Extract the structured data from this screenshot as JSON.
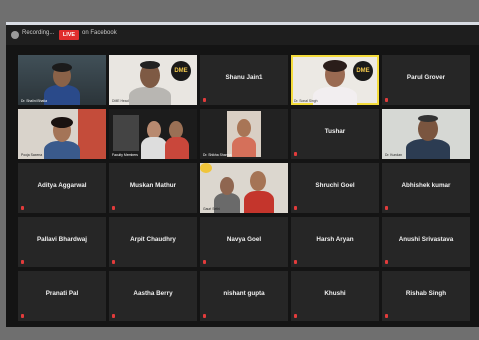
{
  "toolbar": {
    "recording": "Recording...",
    "live": "LIVE",
    "stream": "on Facebook"
  },
  "participants": [
    {
      "name": "Dr. Shalini Bhatia",
      "caption": "Dr. Shalini Bhatia"
    },
    {
      "name": "DME Head",
      "caption": "DME Head"
    },
    {
      "name": "Shanu Jain1"
    },
    {
      "name": "DME Host",
      "caption": "Dr. Sonal Singh"
    },
    {
      "name": "Parul Grover"
    },
    {
      "name": "Pooja Saxena",
      "caption": "Pooja Saxena"
    },
    {
      "name": "Faculty Members",
      "caption": "Faculty Members"
    },
    {
      "name": "Dr. Shikha Sharma",
      "caption": "Dr. Shikha Sharma"
    },
    {
      "name": "Tushar"
    },
    {
      "name": "Dr. Kundan",
      "caption": "Dr. Kundan"
    },
    {
      "name": "Aditya Aggarwal"
    },
    {
      "name": "Muskan Mathur"
    },
    {
      "name": "Gauri Sethi",
      "caption": "Gauri Sethi"
    },
    {
      "name": "Shruchi Goel"
    },
    {
      "name": "Abhishek kumar"
    },
    {
      "name": "Pallavi Bhardwaj"
    },
    {
      "name": "Arpit Chaudhry"
    },
    {
      "name": "Navya Goel"
    },
    {
      "name": "Harsh Aryan"
    },
    {
      "name": "Anushi Srivastava"
    },
    {
      "name": "Pranati Pal"
    },
    {
      "name": "Aastha Berry"
    },
    {
      "name": "nishant gupta"
    },
    {
      "name": "Khushi"
    },
    {
      "name": "Rishab Singh"
    }
  ],
  "logo_text": "DME",
  "colors": {
    "accent": "#f4dc3c",
    "live": "#e02d2d"
  }
}
